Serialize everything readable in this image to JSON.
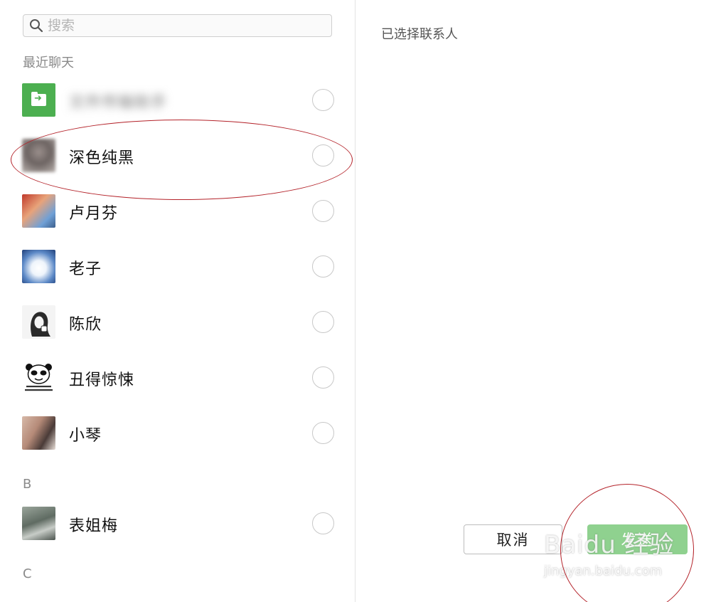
{
  "search": {
    "placeholder": "搜索",
    "value": ""
  },
  "sections": {
    "recent": "最近聊天",
    "b": "B",
    "c": "C"
  },
  "contacts": [
    {
      "name": "文件传输助手",
      "avatar": "file-transfer"
    },
    {
      "name": "深色纯黑",
      "avatar": "blurred-photo"
    },
    {
      "name": "卢月芬",
      "avatar": "kids-photo"
    },
    {
      "name": "老子",
      "avatar": "snow-photo"
    },
    {
      "name": "陈欣",
      "avatar": "sketch-portrait"
    },
    {
      "name": "丑得惊悚",
      "avatar": "panda-meme"
    },
    {
      "name": "小琴",
      "avatar": "selfie-photo"
    }
  ],
  "contacts_b": [
    {
      "name": "表姐梅",
      "avatar": "nature-photo"
    }
  ],
  "right": {
    "title": "已选择联系人"
  },
  "buttons": {
    "cancel": "取消",
    "send": "发送"
  },
  "watermark": {
    "brand": "Baidu 经验",
    "url": "jingyan.baidu.com"
  },
  "colors": {
    "send_bg": "#8fd18f",
    "annotation": "#b4232a",
    "file_icon_bg": "#4caf50"
  }
}
